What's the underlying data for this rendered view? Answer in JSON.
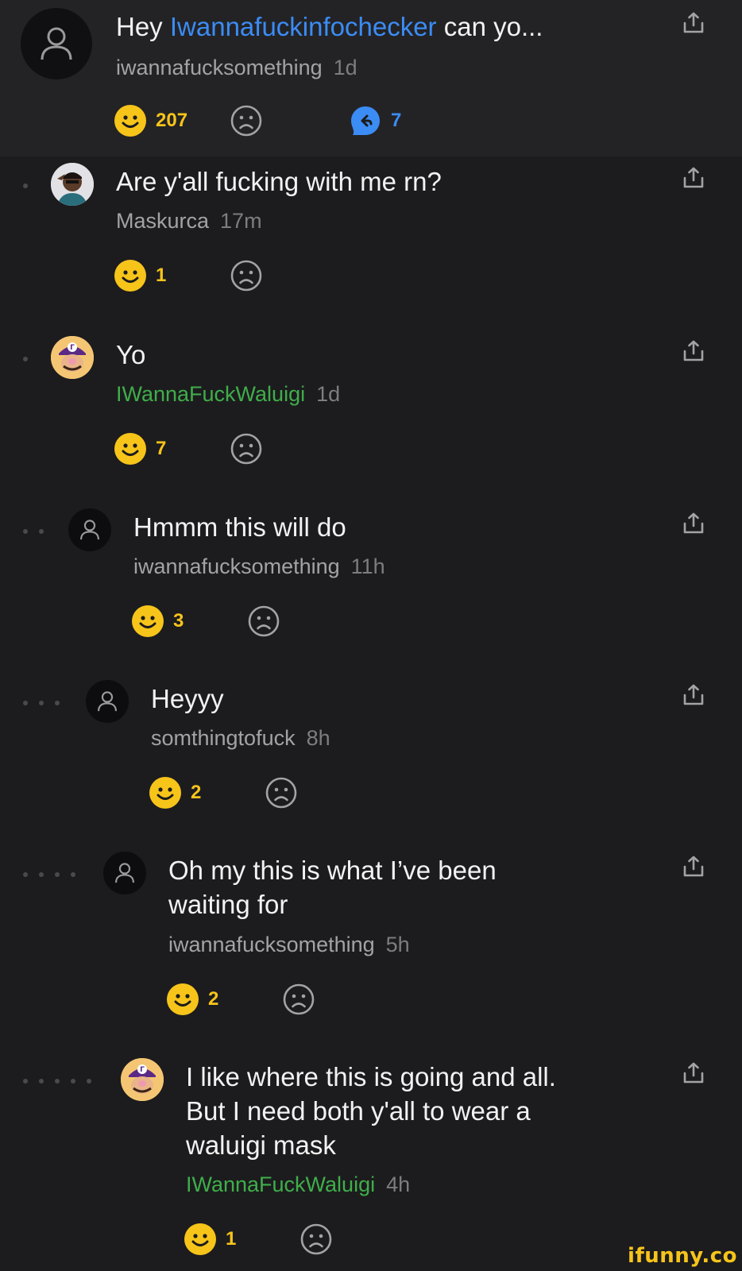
{
  "colors": {
    "background": "#1c1c1e",
    "top_comment_bg": "#232325",
    "mention": "#3b8cf5",
    "smile": "#f7c41a",
    "green_name": "#3fae4a"
  },
  "top_comment": {
    "text_prefix": "Hey ",
    "mention": "Iwannafuckinfochecker",
    "text_suffix": " can yo...",
    "author": "iwannafucksomething",
    "time": "1d",
    "smiles": "207",
    "replies": "7"
  },
  "comments": [
    {
      "text": "Are y'all fucking with me rn?",
      "author": "Maskurca",
      "time": "17m",
      "smiles": "1"
    },
    {
      "text": "Yo",
      "author": "IWannaFuckWaluigi",
      "time": "1d",
      "smiles": "7"
    },
    {
      "text": "Hmmm this will do",
      "author": "iwannafucksomething",
      "time": "11h",
      "smiles": "3"
    },
    {
      "text": "Heyyy",
      "author": "somthingtofuck",
      "time": "8h",
      "smiles": "2"
    },
    {
      "text_line1": "Oh my this is what I’ve been",
      "text_line2": "waiting for",
      "author": "iwannafucksomething",
      "time": "5h",
      "smiles": "2"
    },
    {
      "text_line1": "I like where this is going and all.",
      "text_line2": "But I need both y'all to wear a",
      "text_line3": "waluigi mask",
      "author": "IWannaFuckWaluigi",
      "time": "4h",
      "smiles": "1"
    }
  ],
  "icons": {
    "smile": "smile-icon",
    "frown": "frown-icon",
    "reply": "reply-icon",
    "share": "share-icon",
    "avatar": "user-icon"
  },
  "watermark": "ifunny.co"
}
